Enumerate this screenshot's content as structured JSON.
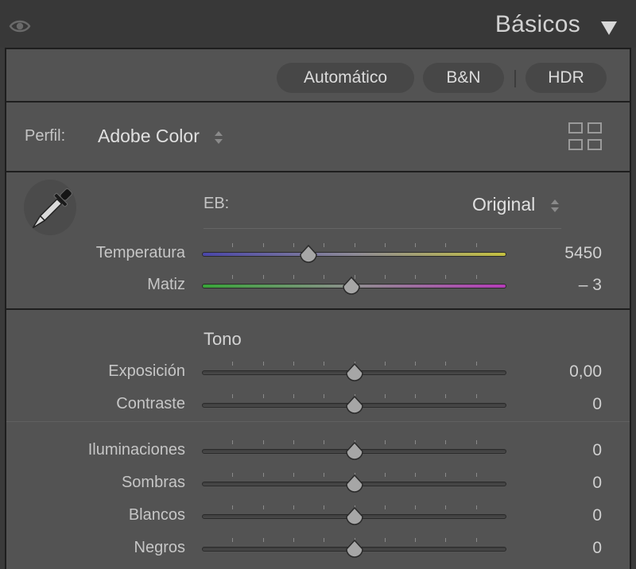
{
  "header": {
    "title": "Básicos",
    "visibility_icon": "eye-icon",
    "collapse_icon": "triangle-down-icon"
  },
  "treatment": {
    "auto_label": "Automático",
    "bw_label": "B&N",
    "hdr_label": "HDR"
  },
  "profile": {
    "label": "Perfil:",
    "value": "Adobe Color",
    "browser_icon": "grid-icon"
  },
  "white_balance": {
    "label": "EB:",
    "value": "Original",
    "eyedropper_icon": "eyedropper-icon",
    "sliders": [
      {
        "label": "Temperatura",
        "value": "5450",
        "position": 0.35
      },
      {
        "label": "Matiz",
        "value": "– 3",
        "position": 0.49
      }
    ]
  },
  "tone": {
    "heading": "Tono",
    "sliders": [
      {
        "label": "Exposición",
        "value": "0,00",
        "position": 0.5
      },
      {
        "label": "Contraste",
        "value": "0",
        "position": 0.5
      }
    ]
  },
  "tone_detail": {
    "sliders": [
      {
        "label": "Iluminaciones",
        "value": "0",
        "position": 0.5
      },
      {
        "label": "Sombras",
        "value": "0",
        "position": 0.5
      },
      {
        "label": "Blancos",
        "value": "0",
        "position": 0.5
      },
      {
        "label": "Negros",
        "value": "0",
        "position": 0.5
      }
    ]
  },
  "colors": {
    "panel_bg": "#535353",
    "header_bg": "#383838",
    "border": "#1e1e1e",
    "temp_gradient": [
      "#4a46a8",
      "#c4c040"
    ],
    "tint_gradient": [
      "#38a438",
      "#b43cb8"
    ]
  }
}
